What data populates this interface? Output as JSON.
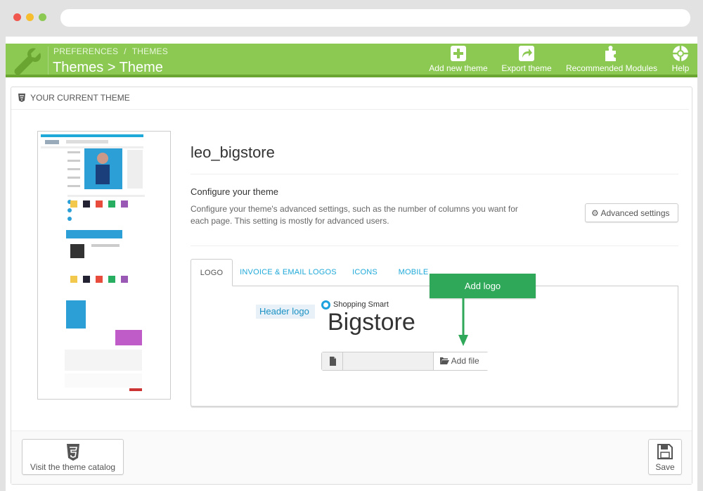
{
  "header": {
    "breadcrumb": [
      "PREFERENCES",
      "THEMES"
    ],
    "breadcrumb_sep": "/",
    "title": "Themes > Theme",
    "toolbar": [
      {
        "label": "Add new theme",
        "icon": "plus-square-icon"
      },
      {
        "label": "Export theme",
        "icon": "export-icon"
      },
      {
        "label": "Recommended Modules",
        "icon": "puzzle-icon"
      },
      {
        "label": "Help",
        "icon": "lifebuoy-icon"
      }
    ]
  },
  "panel": {
    "heading": "YOUR CURRENT THEME",
    "theme_name": "leo_bigstore",
    "configure_title": "Configure your theme",
    "configure_desc": "Configure your theme's advanced settings, such as the number of columns you want for each page. This setting is mostly for advanced users.",
    "advanced_button": "Advanced settings"
  },
  "tabs": [
    {
      "label": "LOGO",
      "active": true
    },
    {
      "label": "INVOICE & EMAIL LOGOS",
      "active": false
    },
    {
      "label": "ICONS",
      "active": false
    },
    {
      "label": "MOBILE",
      "active": false
    }
  ],
  "logo_tab": {
    "header_logo_label": "Header logo",
    "logo_tagline": "Shopping Smart",
    "logo_wordmark": "Bigstore",
    "file_button": "Add file",
    "file_value": ""
  },
  "callout": "Add logo",
  "footer": {
    "catalog_button": "Visit the theme catalog",
    "save_button": "Save"
  },
  "colors": {
    "header_green": "#8bc953",
    "link_blue": "#1fa9d9",
    "callout_green": "#2fa85a"
  }
}
